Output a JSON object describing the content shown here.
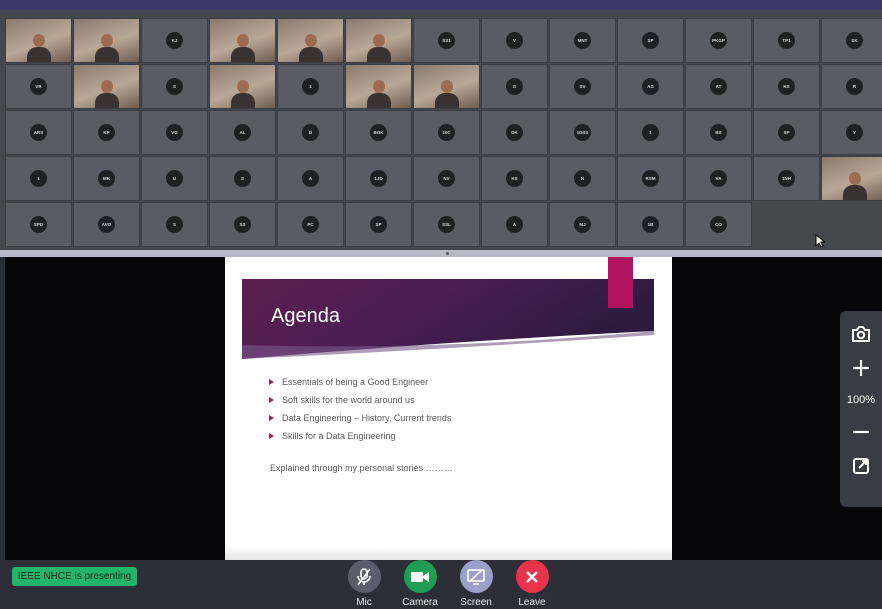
{
  "participants": [
    {
      "type": "video"
    },
    {
      "type": "video"
    },
    {
      "type": "avatar",
      "initials": "KJ"
    },
    {
      "type": "video"
    },
    {
      "type": "video"
    },
    {
      "type": "video"
    },
    {
      "type": "avatar",
      "initials": "SS1"
    },
    {
      "type": "avatar",
      "initials": "V"
    },
    {
      "type": "avatar",
      "initials": "MNT"
    },
    {
      "type": "avatar",
      "initials": "SP"
    },
    {
      "type": "avatar",
      "initials": "PKGP"
    },
    {
      "type": "avatar",
      "initials": "TP1"
    },
    {
      "type": "avatar",
      "initials": "SK"
    },
    {
      "type": "avatar",
      "initials": "VR"
    },
    {
      "type": "video"
    },
    {
      "type": "avatar",
      "initials": "S"
    },
    {
      "type": "video"
    },
    {
      "type": "avatar",
      "initials": "1"
    },
    {
      "type": "video"
    },
    {
      "type": "video"
    },
    {
      "type": "avatar",
      "initials": "G"
    },
    {
      "type": "avatar",
      "initials": "SV"
    },
    {
      "type": "avatar",
      "initials": "AG"
    },
    {
      "type": "avatar",
      "initials": "AT"
    },
    {
      "type": "avatar",
      "initials": "KS"
    },
    {
      "type": "avatar",
      "initials": "R"
    },
    {
      "type": "avatar",
      "initials": "ARS"
    },
    {
      "type": "avatar",
      "initials": "KP"
    },
    {
      "type": "avatar",
      "initials": "VG"
    },
    {
      "type": "avatar",
      "initials": "AL"
    },
    {
      "type": "avatar",
      "initials": "D"
    },
    {
      "type": "avatar",
      "initials": "BOK"
    },
    {
      "type": "avatar",
      "initials": "10C"
    },
    {
      "type": "avatar",
      "initials": "DK"
    },
    {
      "type": "avatar",
      "initials": "1DSS"
    },
    {
      "type": "avatar",
      "initials": "1"
    },
    {
      "type": "avatar",
      "initials": "BS"
    },
    {
      "type": "avatar",
      "initials": "SP"
    },
    {
      "type": "avatar",
      "initials": "Y"
    },
    {
      "type": "avatar",
      "initials": "1"
    },
    {
      "type": "avatar",
      "initials": "MK"
    },
    {
      "type": "avatar",
      "initials": "U"
    },
    {
      "type": "avatar",
      "initials": "S"
    },
    {
      "type": "avatar",
      "initials": "A"
    },
    {
      "type": "avatar",
      "initials": "1JD"
    },
    {
      "type": "avatar",
      "initials": "NV"
    },
    {
      "type": "avatar",
      "initials": "KS"
    },
    {
      "type": "avatar",
      "initials": "N"
    },
    {
      "type": "avatar",
      "initials": "RSM"
    },
    {
      "type": "avatar",
      "initials": "VA"
    },
    {
      "type": "avatar",
      "initials": "1NH"
    },
    {
      "type": "video"
    },
    {
      "type": "avatar",
      "initials": "SPD"
    },
    {
      "type": "avatar",
      "initials": "AVO"
    },
    {
      "type": "avatar",
      "initials": "S"
    },
    {
      "type": "avatar",
      "initials": "SS"
    },
    {
      "type": "avatar",
      "initials": "PC"
    },
    {
      "type": "avatar",
      "initials": "SP"
    },
    {
      "type": "avatar",
      "initials": "SSL"
    },
    {
      "type": "avatar",
      "initials": "A"
    },
    {
      "type": "avatar",
      "initials": "MJ"
    },
    {
      "type": "avatar",
      "initials": "1B"
    },
    {
      "type": "avatar",
      "initials": "CO"
    }
  ],
  "slide": {
    "title": "Agenda",
    "bullets": [
      "Essentials of being a Good Engineer",
      "Soft skills for the world around us",
      "Data Engineering – History, Current trends",
      "Skills for a Data Engineering"
    ],
    "footnote": "Explained through my personal stories ………"
  },
  "zoom": {
    "percent": "100%"
  },
  "presenting_label": "IEEE NHCE is presenting",
  "controls": {
    "mic": "Mic",
    "camera": "Camera",
    "screen": "Screen",
    "leave": "Leave"
  },
  "colors": {
    "accent": "#b2135f",
    "camera_button": "#1f9d55",
    "screen_button": "#9aa0c8",
    "leave_button": "#e8344b",
    "presenting_badge": "#22b46b"
  }
}
